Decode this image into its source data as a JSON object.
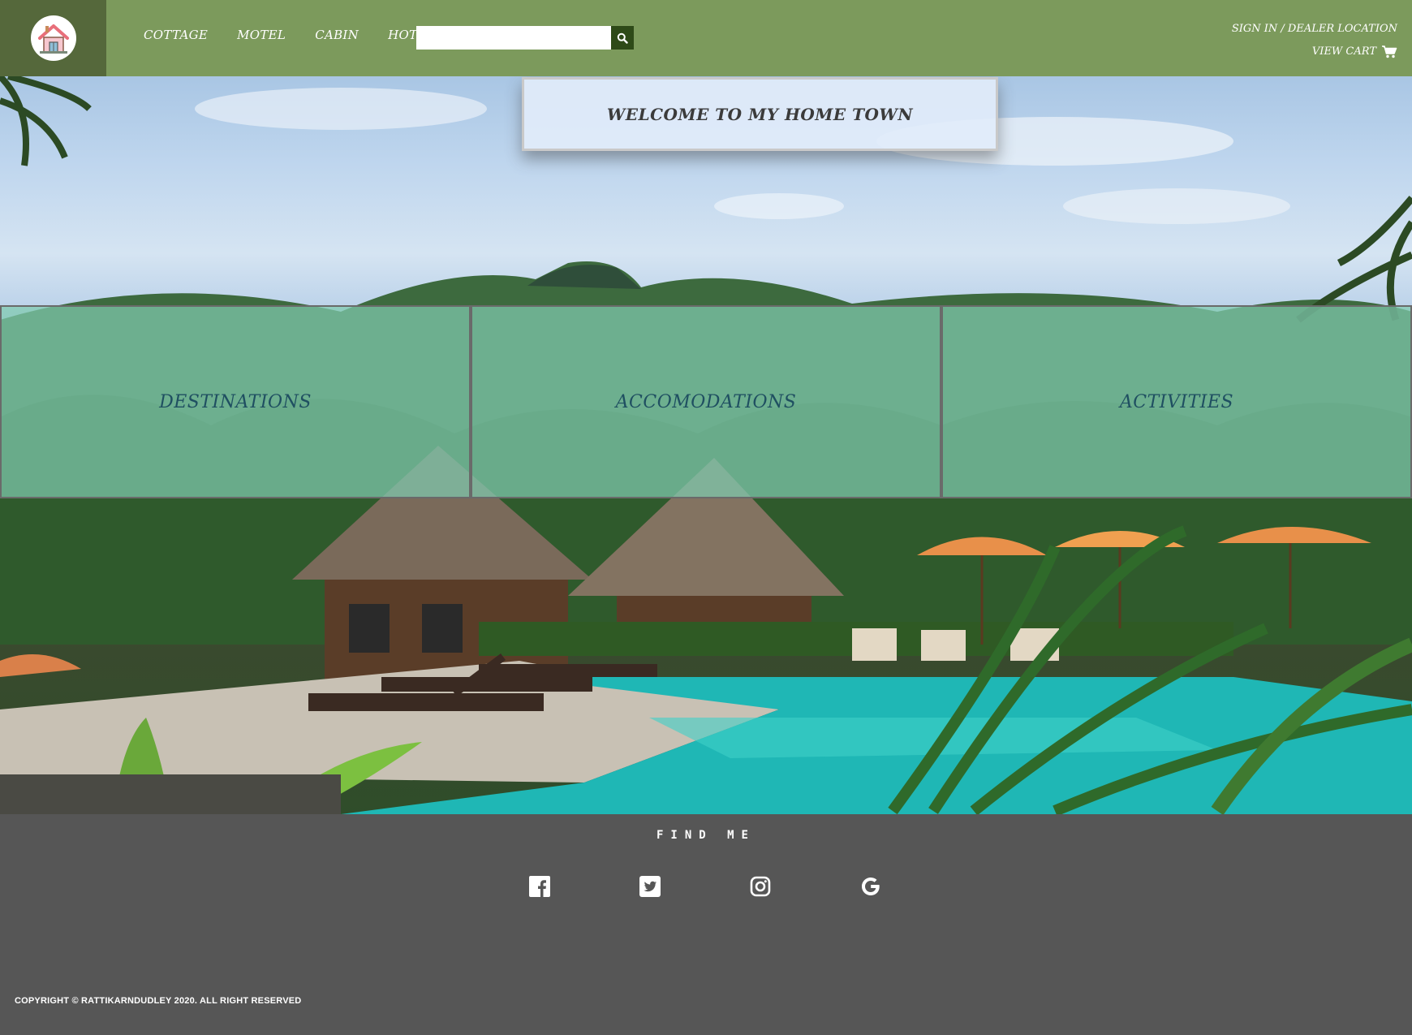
{
  "header": {
    "nav": [
      {
        "label": "COTTAGE"
      },
      {
        "label": "MOTEL"
      },
      {
        "label": "CABIN"
      },
      {
        "label": "HOTEL"
      }
    ],
    "search": {
      "value": "",
      "placeholder": ""
    },
    "account": {
      "sign_in_label": "SIGN IN / DEALER LOCATION",
      "cart_label": "VIEW CART"
    }
  },
  "hero": {
    "welcome": "WELCOME TO MY HOME TOWN",
    "categories": [
      {
        "label": "DESTINATIONS"
      },
      {
        "label": "ACCOMODATIONS"
      },
      {
        "label": "ACTIVITIES"
      }
    ]
  },
  "footer": {
    "find_me": "FIND ME",
    "social_icons": [
      "facebook-icon",
      "twitter-icon",
      "instagram-icon",
      "google-icon"
    ],
    "copyright": "COPYRIGHT © RATTIKARNDUDLEY 2020. ALL RIGHT RESERVED"
  },
  "colors": {
    "header_green": "#7c9a5c",
    "logo_dark_green": "#55683b",
    "search_button": "#2e4a18",
    "category_overlay": "#80cbaf",
    "category_text": "#1f4f61",
    "footer_gray": "#565656"
  }
}
